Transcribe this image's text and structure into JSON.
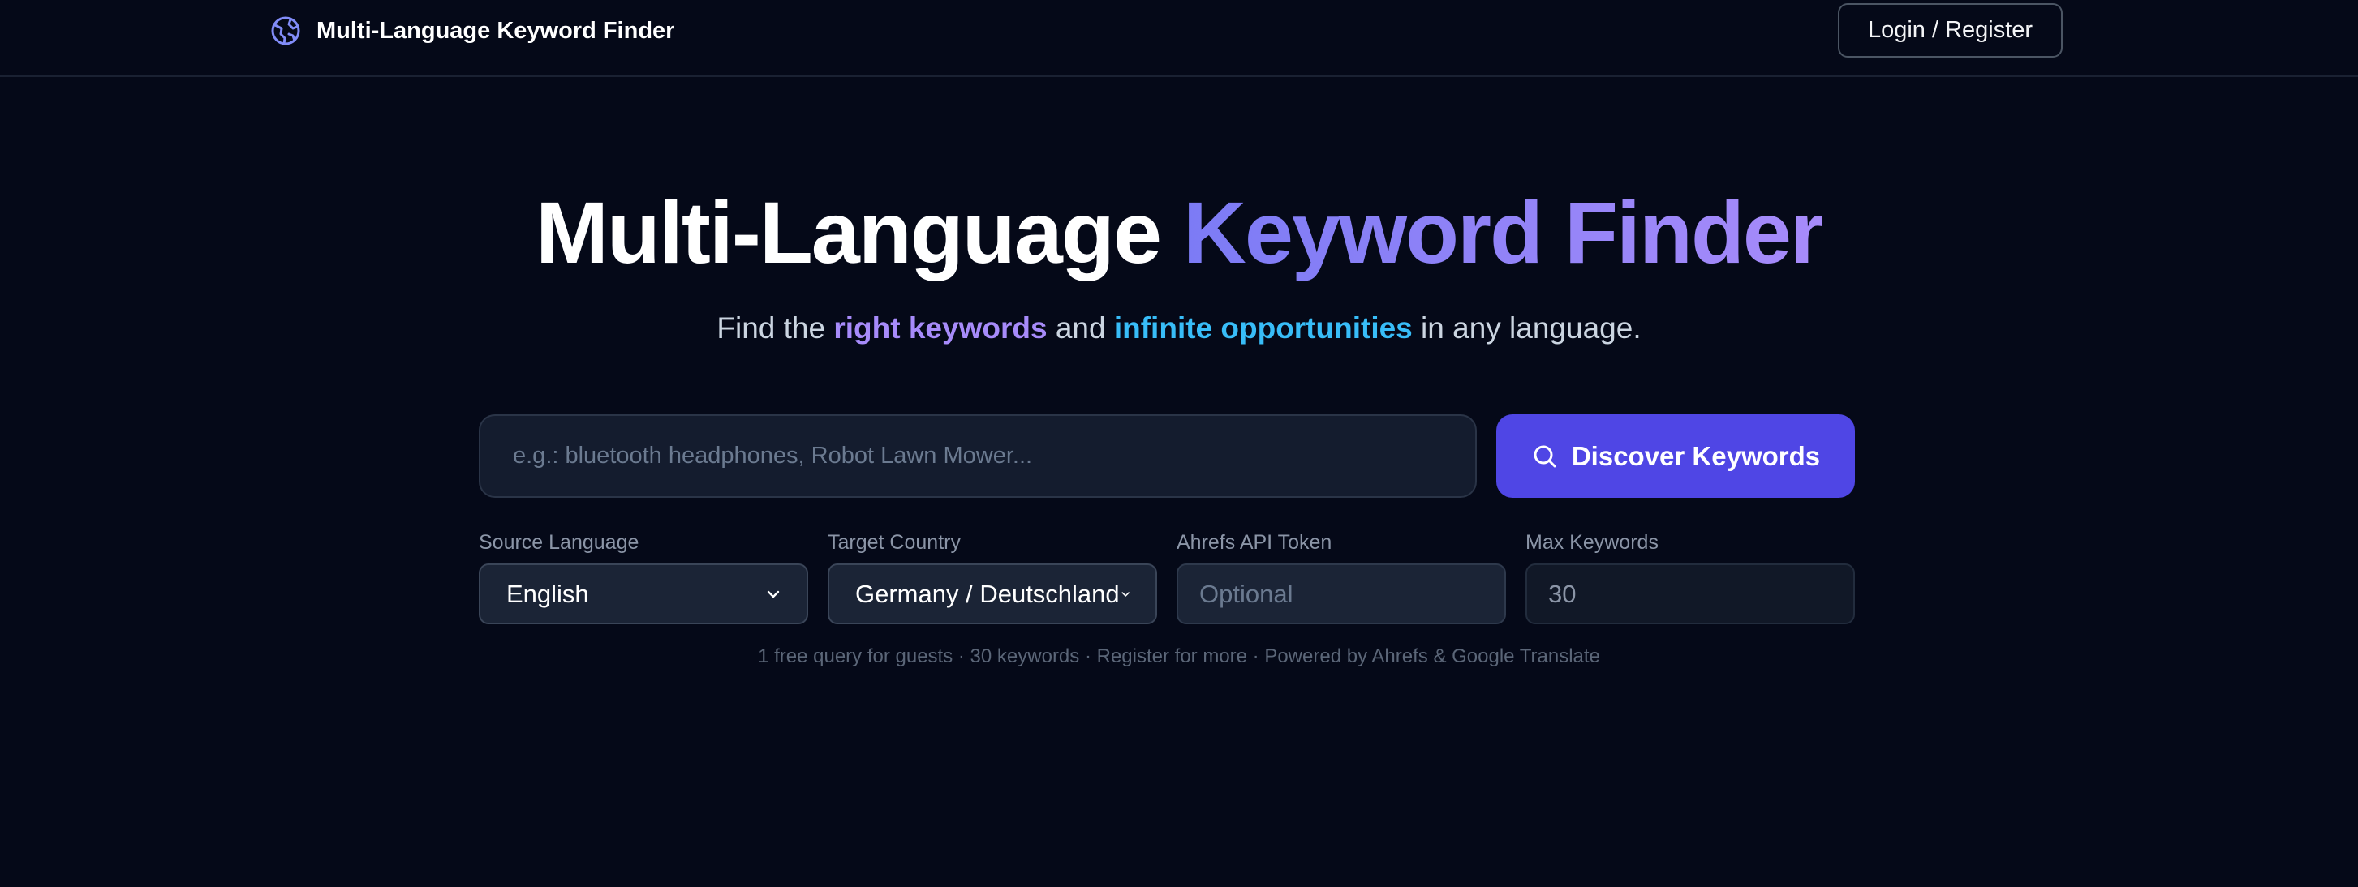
{
  "header": {
    "brand_name": "Multi-Language Keyword Finder",
    "login_label": "Login / Register"
  },
  "hero": {
    "title_plain": "Multi-Language",
    "title_gradient": "Keyword Finder",
    "subtitle_part1": "Find the",
    "subtitle_highlight1": "right keywords",
    "subtitle_part2": "and",
    "subtitle_highlight2": "infinite opportunities",
    "subtitle_part3": "in any language."
  },
  "search": {
    "placeholder": "e.g.: bluetooth headphones, Robot Lawn Mower...",
    "value": "",
    "button_label": "Discover Keywords"
  },
  "options": {
    "source_language": {
      "label": "Source Language",
      "selected": "English"
    },
    "target_country": {
      "label": "Target Country",
      "selected": "Germany / Deutschland"
    },
    "api_token": {
      "label": "Ahrefs API Token",
      "placeholder": "Optional",
      "value": ""
    },
    "max_keywords": {
      "label": "Max Keywords",
      "value": "30"
    }
  },
  "footnote": "1 free query for guests · 30 keywords · Register for more · Powered by Ahrefs & Google Translate",
  "colors": {
    "background": "#050918",
    "accent": "#4f46e5",
    "highlight_purple": "#a78bfa",
    "highlight_blue": "#38bdf8"
  },
  "icons": {
    "brand": "globe-icon",
    "discover": "search-icon",
    "select": "chevron-down-icon",
    "token": "eye-icon"
  }
}
